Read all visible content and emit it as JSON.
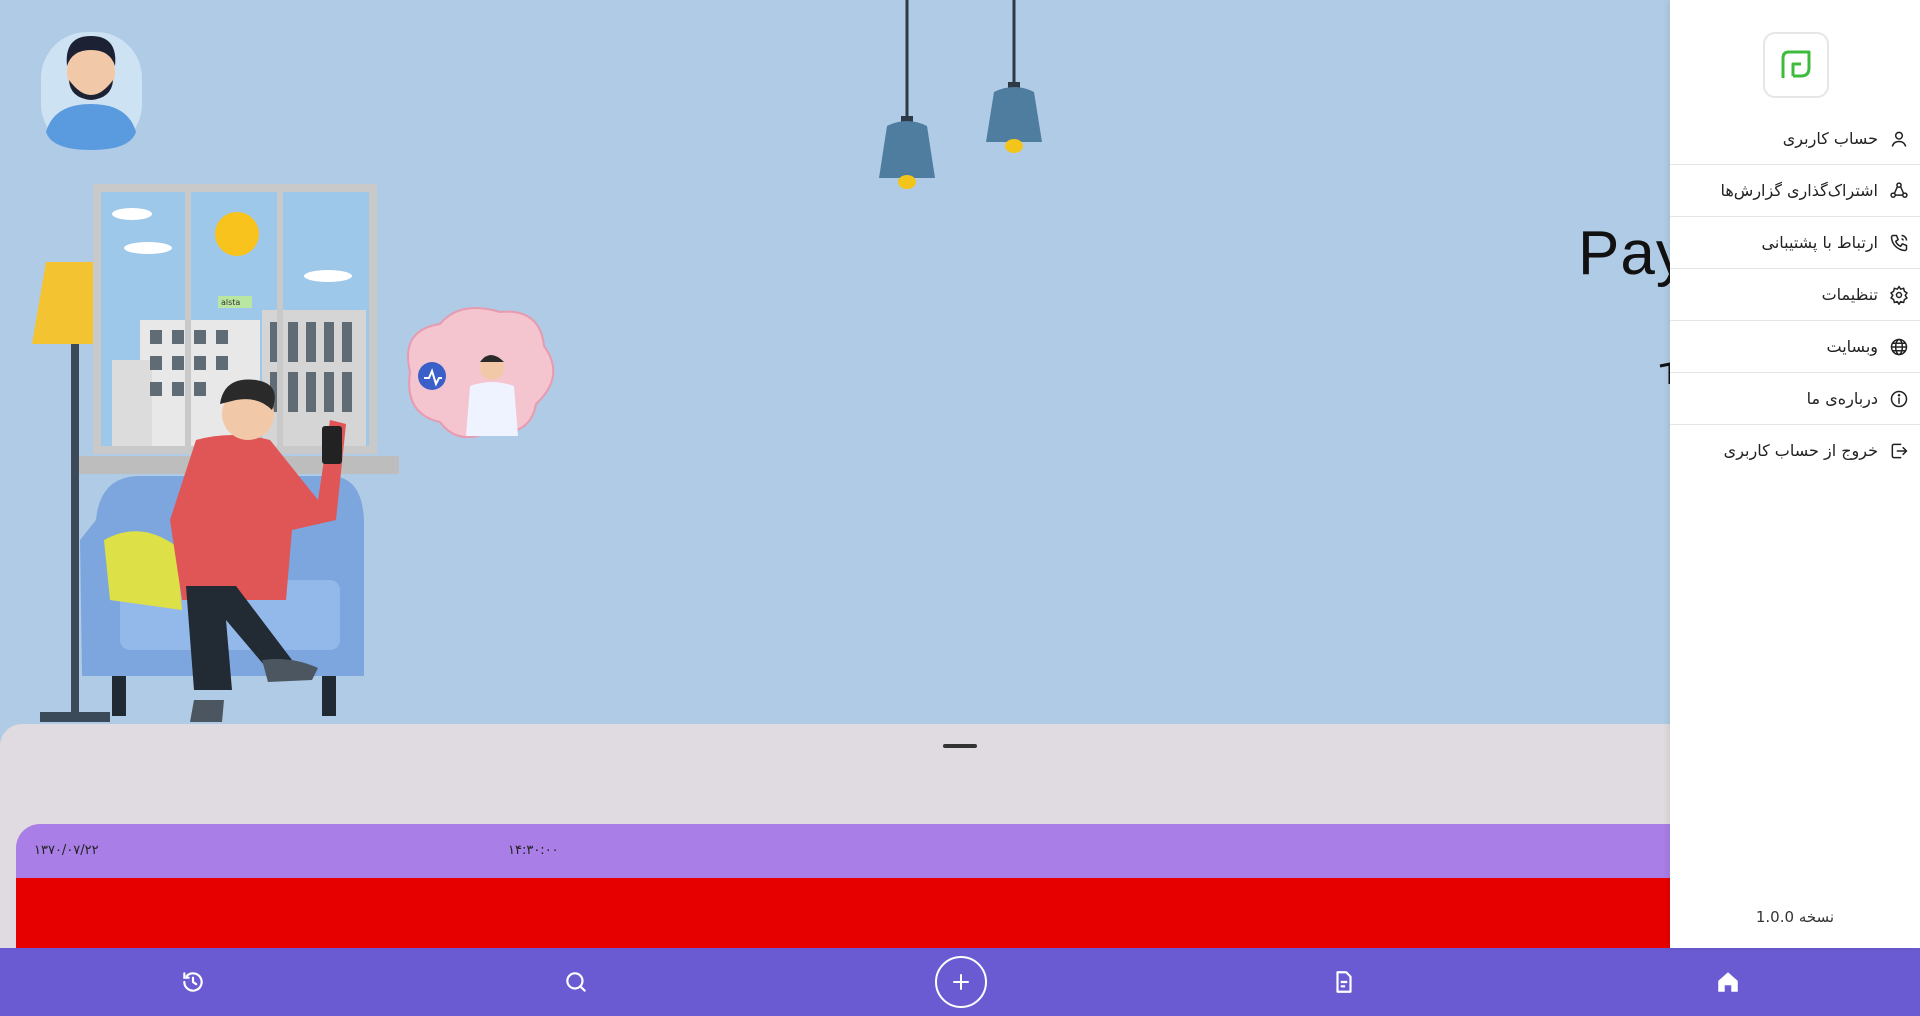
{
  "hero": {
    "title_fragment": "Pay"
  },
  "record": {
    "date": "۱۳۷۰/۰۷/۲۲",
    "time": "۱۴:۳۰:۰۰"
  },
  "illustration": {
    "building_sign": "alsta"
  },
  "drawer": {
    "menu": [
      {
        "label": "حساب کاربری",
        "icon": "user-icon"
      },
      {
        "label": "اشتراک‌گذاری گزارش‌ها",
        "icon": "share-icon"
      },
      {
        "label": "ارتباط با پشتیبانی",
        "icon": "phone-icon"
      },
      {
        "label": "تنظیمات",
        "icon": "gear-icon"
      },
      {
        "label": "وبسایت",
        "icon": "globe-icon"
      },
      {
        "label": "درباره‌ی ما",
        "icon": "info-icon"
      },
      {
        "label": "خروج از حساب کاربری",
        "icon": "logout-icon"
      }
    ],
    "version": "نسخه 1.0.0"
  },
  "bottom_nav": {
    "items": [
      "history-icon",
      "search-icon",
      "add-icon",
      "report-icon",
      "home-icon"
    ]
  },
  "colors": {
    "background": "#b0cbe5",
    "nav": "#6b5bd2",
    "card_header": "#a97ee6",
    "card_body": "#e60000",
    "logo_green": "#3dbb3d"
  }
}
